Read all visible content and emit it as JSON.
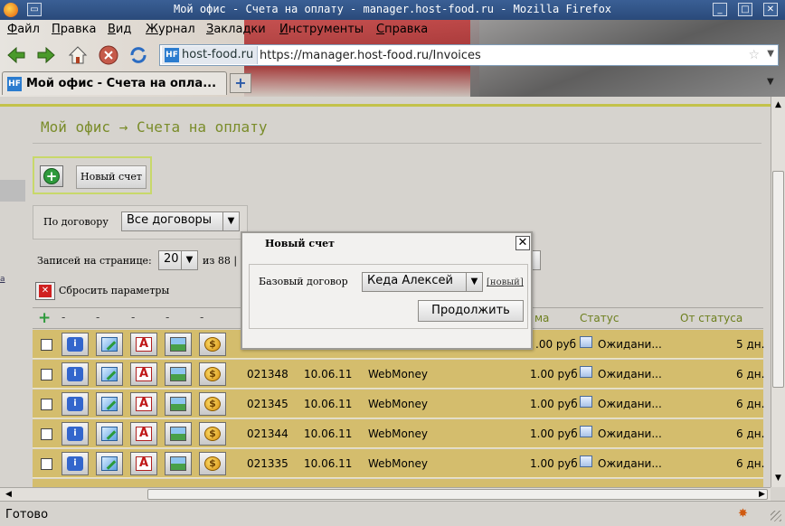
{
  "window": {
    "title": "Мой офис - Счета на оплату - manager.host-food.ru - Mozilla Firefox"
  },
  "menu": [
    {
      "label": "Файл",
      "accel": "Ф",
      "rest": "айл"
    },
    {
      "label": "Правка",
      "accel": "П",
      "rest": "равка"
    },
    {
      "label": "Вид",
      "accel": "В",
      "rest": "ид"
    },
    {
      "label": "Журнал",
      "accel": "Ж",
      "rest": "урнал"
    },
    {
      "label": "Закладки",
      "accel": "З",
      "rest": "акладки"
    },
    {
      "label": "Инструменты",
      "accel": "И",
      "rest": "нструменты"
    },
    {
      "label": "Справка",
      "accel": "С",
      "rest": "правка"
    }
  ],
  "urlbar": {
    "site": "host-food.ru",
    "url": "https://manager.host-food.ru/Invoices",
    "favicon": "HF"
  },
  "tab": {
    "label": "Мой офис - Счета на опла...",
    "favicon": "HF"
  },
  "page": {
    "breadcrumb": "Мой офис → Счета на оплату",
    "new_invoice_label": "Новый счет",
    "filter_label": "По договору",
    "filter_value": "Все договоры",
    "per_page_label": "Записей на странице:",
    "per_page_value": "20",
    "per_page_of": "из 88 |",
    "reset_label": "Сбросить параметры"
  },
  "table": {
    "dashes": [
      "-",
      "-",
      "-",
      "-",
      "-"
    ],
    "headers": {
      "amount": "ма",
      "status": "Статус",
      "from_status": "От статуса"
    },
    "rows": [
      {
        "num": "",
        "date": "",
        "method": "",
        "amount": ".00 руб",
        "status": "Ожидани...",
        "days": "5 дн."
      },
      {
        "num": "021348",
        "date": "10.06.11",
        "method": "WebMoney",
        "amount": "1.00 руб",
        "status": "Ожидани...",
        "days": "6 дн."
      },
      {
        "num": "021345",
        "date": "10.06.11",
        "method": "WebMoney",
        "amount": "1.00 руб",
        "status": "Ожидани...",
        "days": "6 дн."
      },
      {
        "num": "021344",
        "date": "10.06.11",
        "method": "WebMoney",
        "amount": "1.00 руб",
        "status": "Ожидани...",
        "days": "6 дн."
      },
      {
        "num": "021335",
        "date": "10.06.11",
        "method": "WebMoney",
        "amount": "1.00 руб",
        "status": "Ожидани...",
        "days": "6 дн."
      }
    ]
  },
  "modal": {
    "title": "Новый счет",
    "label": "Базовый договор",
    "select_value": "Кеда Алексей",
    "new_link": "[новый]",
    "continue_label": "Продолжить"
  },
  "status": {
    "text": "Готово"
  },
  "colors": {
    "accent_green": "#7a8c2a",
    "row_bg": "#d4bd6d",
    "title_bar": "#3a5f95"
  }
}
